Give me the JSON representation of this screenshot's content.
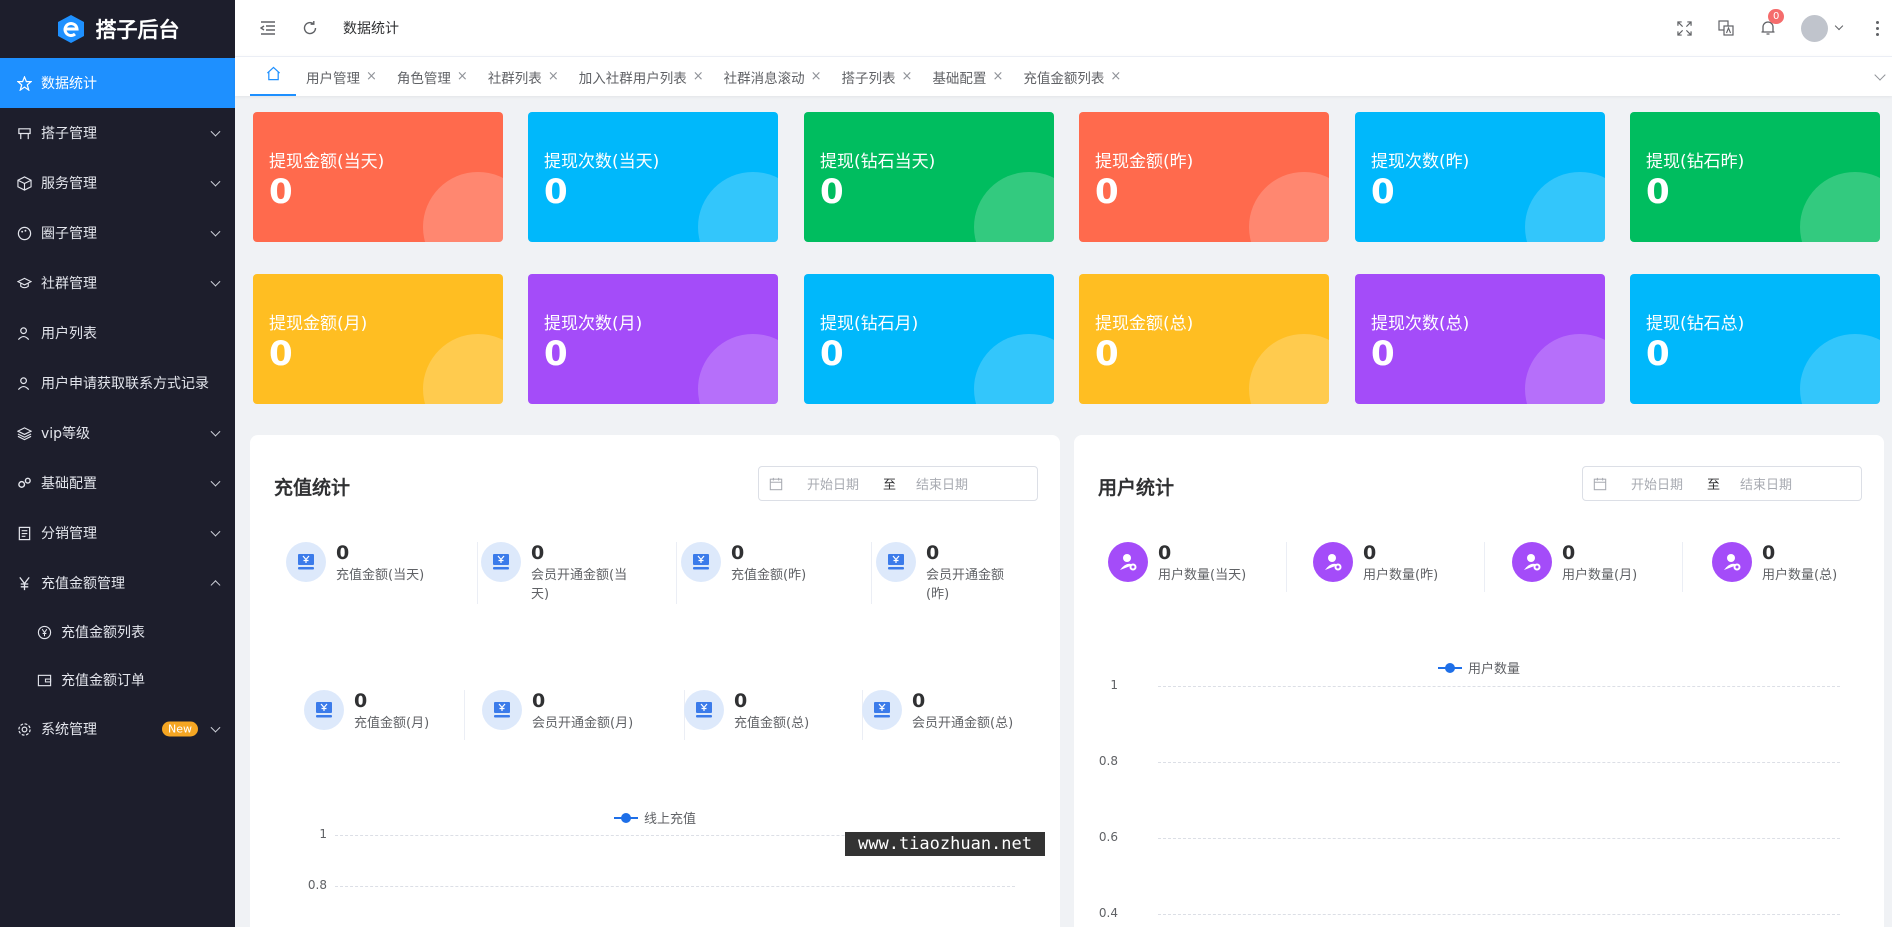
{
  "app": {
    "logo_text": "搭子后台"
  },
  "sidebar": {
    "items": [
      {
        "label": "数据统计",
        "icon": "star-icon"
      },
      {
        "label": "搭子管理",
        "icon": "chair-icon"
      },
      {
        "label": "服务管理",
        "icon": "box-icon"
      },
      {
        "label": "圈子管理",
        "icon": "palette-icon"
      },
      {
        "label": "社群管理",
        "icon": "graduation-icon"
      },
      {
        "label": "用户列表",
        "icon": "user-icon"
      },
      {
        "label": "用户申请获取联系方式记录",
        "icon": "user-icon"
      },
      {
        "label": "vip等级",
        "icon": "layers-icon"
      },
      {
        "label": "基础配置",
        "icon": "gears-icon"
      },
      {
        "label": "分销管理",
        "icon": "document-icon"
      },
      {
        "label": "充值金额管理",
        "icon": "yen-icon"
      }
    ],
    "sub_items": [
      {
        "label": "充值金额列表",
        "icon": "yen-circle-icon"
      },
      {
        "label": "充值金额订单",
        "icon": "wallet-icon"
      }
    ],
    "system": {
      "label": "系统管理",
      "badge": "New",
      "icon": "gear-icon"
    }
  },
  "header": {
    "breadcrumb": "数据统计",
    "notification_count": "0"
  },
  "tabs": [
    "用户管理",
    "角色管理",
    "社群列表",
    "加入社群用户列表",
    "社群消息滚动",
    "搭子列表",
    "基础配置",
    "充值金额列表"
  ],
  "tab_close": "×",
  "cards": [
    {
      "title": "提现金额(当天)",
      "value": "0",
      "color": "#ff6a4d"
    },
    {
      "title": "提现次数(当天)",
      "value": "0",
      "color": "#00b8fb"
    },
    {
      "title": "提现(钻石当天)",
      "value": "0",
      "color": "#00bd5f"
    },
    {
      "title": "提现金额(昨)",
      "value": "0",
      "color": "#ff6a4d"
    },
    {
      "title": "提现次数(昨)",
      "value": "0",
      "color": "#00b8fb"
    },
    {
      "title": "提现(钻石昨)",
      "value": "0",
      "color": "#00bd5f"
    },
    {
      "title": "提现金额(月)",
      "value": "0",
      "color": "#ffbe22"
    },
    {
      "title": "提现次数(月)",
      "value": "0",
      "color": "#a44cf9"
    },
    {
      "title": "提现(钻石月)",
      "value": "0",
      "color": "#00b8fb"
    },
    {
      "title": "提现金额(总)",
      "value": "0",
      "color": "#ffbe22"
    },
    {
      "title": "提现次数(总)",
      "value": "0",
      "color": "#a44cf9"
    },
    {
      "title": "提现(钻石总)",
      "value": "0",
      "color": "#00b8fb"
    }
  ],
  "recharge": {
    "title": "充值统计",
    "date_start_placeholder": "开始日期",
    "date_sep": "至",
    "date_end_placeholder": "结束日期",
    "stats_row1": [
      {
        "value": "0",
        "label": "充值金额(当天)"
      },
      {
        "value": "0",
        "label": "会员开通金额(当天)"
      },
      {
        "value": "0",
        "label": "充值金额(昨)"
      },
      {
        "value": "0",
        "label": "会员开通金额(昨)"
      }
    ],
    "stats_row2": [
      {
        "value": "0",
        "label": "充值金额(月)"
      },
      {
        "value": "0",
        "label": "会员开通金额(月)"
      },
      {
        "value": "0",
        "label": "充值金额(总)"
      },
      {
        "value": "0",
        "label": "会员开通金额(总)"
      }
    ],
    "chart_legend": "线上充值",
    "y_ticks": [
      "1",
      "0.8"
    ]
  },
  "users": {
    "title": "用户统计",
    "date_start_placeholder": "开始日期",
    "date_sep": "至",
    "date_end_placeholder": "结束日期",
    "stats": [
      {
        "value": "0",
        "label": "用户数量(当天)"
      },
      {
        "value": "0",
        "label": "用户数量(昨)"
      },
      {
        "value": "0",
        "label": "用户数量(月)"
      },
      {
        "value": "0",
        "label": "用户数量(总)"
      }
    ],
    "chart_legend": "用户数量",
    "y_ticks": [
      "1",
      "0.8",
      "0.6",
      "0.4"
    ]
  },
  "watermark": "www.tiaozhuan.net"
}
